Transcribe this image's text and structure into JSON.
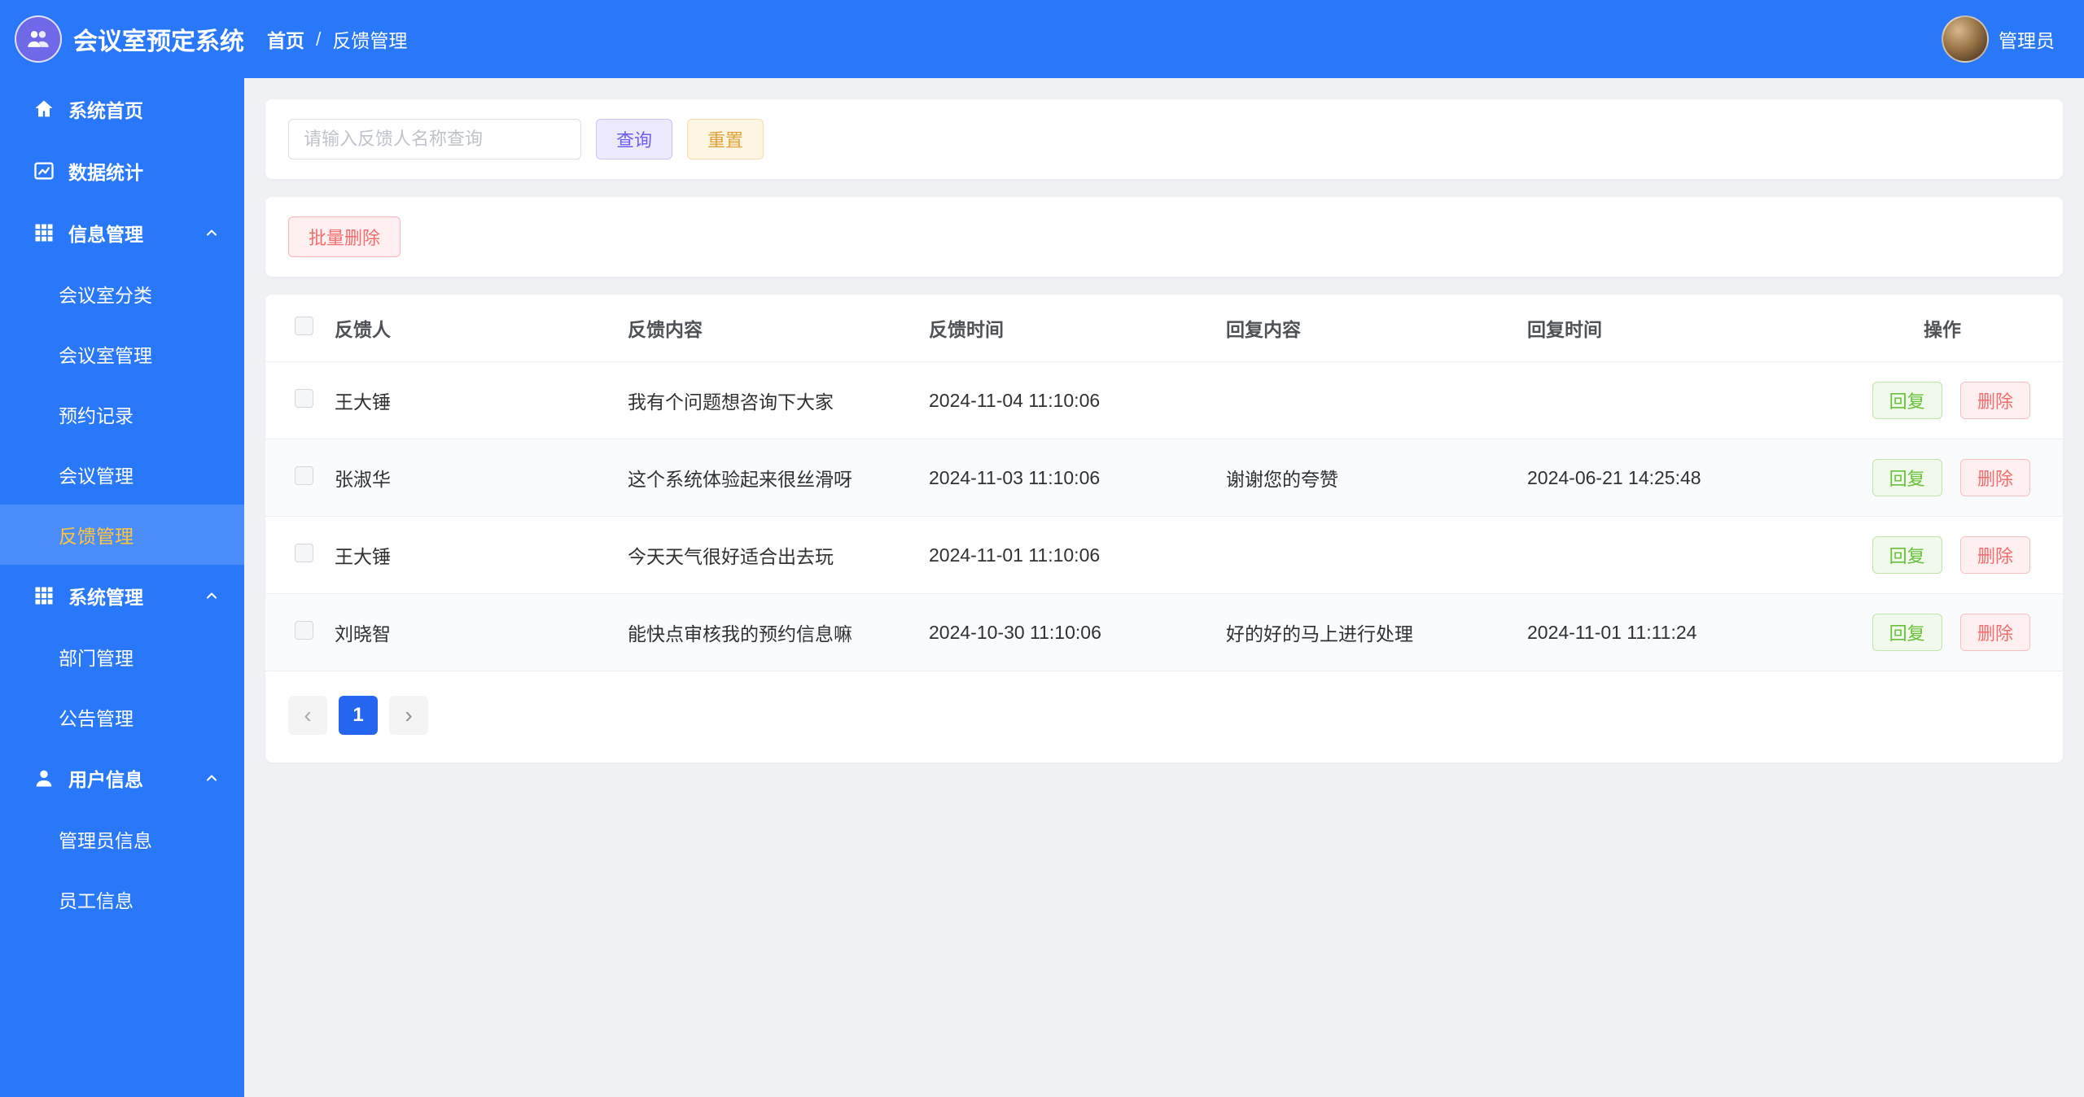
{
  "header": {
    "app_title": "会议室预定系统",
    "breadcrumb_home": "首页",
    "breadcrumb_separator": "/",
    "breadcrumb_current": "反馈管理",
    "user_name": "管理员"
  },
  "sidebar": {
    "home_label": "系统首页",
    "stats_label": "数据统计",
    "info_group_label": "信息管理",
    "info_children": [
      "会议室分类",
      "会议室管理",
      "预约记录",
      "会议管理",
      "反馈管理"
    ],
    "system_group_label": "系统管理",
    "system_children": [
      "部门管理",
      "公告管理"
    ],
    "user_group_label": "用户信息",
    "user_children": [
      "管理员信息",
      "员工信息"
    ],
    "active_item": "反馈管理"
  },
  "toolbar": {
    "search_placeholder": "请输入反馈人名称查询",
    "query_label": "查询",
    "reset_label": "重置",
    "batch_delete_label": "批量删除"
  },
  "table": {
    "headers": [
      "反馈人",
      "反馈内容",
      "反馈时间",
      "回复内容",
      "回复时间",
      "操作"
    ],
    "rows": [
      {
        "name": "王大锤",
        "content": "我有个问题想咨询下大家",
        "time": "2024-11-04 11:10:06",
        "reply": "",
        "reply_time": ""
      },
      {
        "name": "张淑华",
        "content": "这个系统体验起来很丝滑呀",
        "time": "2024-11-03 11:10:06",
        "reply": "谢谢您的夸赞",
        "reply_time": "2024-06-21 14:25:48"
      },
      {
        "name": "王大锤",
        "content": "今天天气很好适合出去玩",
        "time": "2024-11-01 11:10:06",
        "reply": "",
        "reply_time": ""
      },
      {
        "name": "刘晓智",
        "content": "能快点审核我的预约信息嘛",
        "time": "2024-10-30 11:10:06",
        "reply": "好的好的马上进行处理",
        "reply_time": "2024-11-01 11:11:24"
      }
    ],
    "reply_label": "回复",
    "delete_label": "删除"
  },
  "pagination": {
    "prev_icon": "‹",
    "next_icon": "›",
    "current_page": "1"
  },
  "colors": {
    "primary_blue": "#2878f9",
    "active_menu_text": "#ffc53d",
    "query_purple": "#6c5df5",
    "reset_orange": "#e2a23a",
    "danger_red": "#f56c6c",
    "success_green": "#67c23a"
  }
}
